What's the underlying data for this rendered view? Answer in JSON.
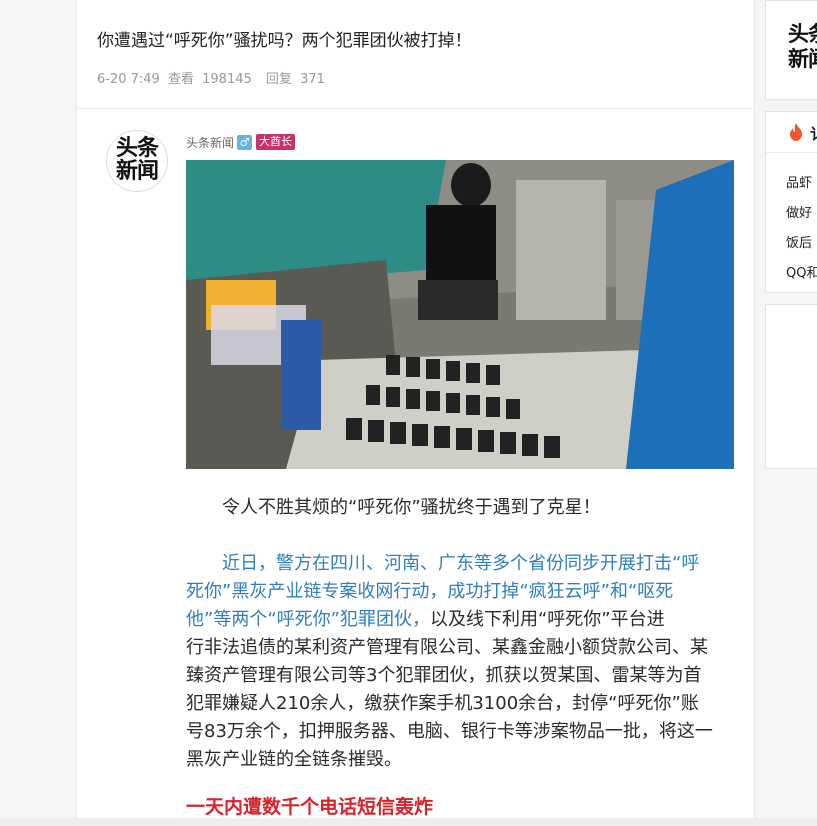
{
  "post": {
    "title": "你遭遇过“呼死你”骚扰吗？两个犯罪团伙被打掉！",
    "date": "6-20 7:49",
    "views_label": "查看",
    "views": "198145",
    "replies_label": "回复",
    "replies": "371"
  },
  "author": {
    "avatar_text": "头条新闻",
    "name": "头条新闻",
    "gender_symbol": "♂",
    "rank": "大酋长"
  },
  "article": {
    "intro": "令人不胜其烦的“呼死你”骚扰终于遇到了克星！",
    "p2_lines": [
      {
        "blue": "近日，警方在四川、河南、广东等多个省份同步开展打击“呼",
        "rest": ""
      },
      {
        "blue": "死你”黑灰产业链专案收网行动，成功打掉“疯狂云呼”和“呕死",
        "rest": ""
      },
      {
        "blue": "他”等两个“呼死你”犯罪团伙，",
        "rest": "以及线下利用“呼死你”平台进"
      },
      {
        "blue": "",
        "rest": "行非法追债的某利资产管理有限公司、某鑫金融小额贷款公司、某"
      },
      {
        "blue": "",
        "rest": "臻资产管理有限公司等3个犯罪团伙，抓获以贺某国、雷某等为首"
      },
      {
        "blue": "",
        "rest": "犯罪嫌疑人210余人，缴获作案手机3100余台，封停“呼死你”账"
      },
      {
        "blue": "",
        "rest": "号83万余个，扣押服务器、电脑、银行卡等涉案物品一批，将这一"
      },
      {
        "blue": "",
        "rest": "黑灰产业链的全链条摧毁。"
      }
    ],
    "subheading": "一天内遭数千个电话短信轰炸"
  },
  "sidebar": {
    "logo_text": "头条新闻",
    "hot_title_char": "讠",
    "hot_items": [
      "品虾",
      "做好",
      "饭后",
      "QQ和"
    ]
  },
  "colors": {
    "link_blue": "#2e7fc1",
    "subheading_red": "#d8232a",
    "rank_badge": "#c7326a",
    "gender_badge": "#5fb7e8"
  }
}
